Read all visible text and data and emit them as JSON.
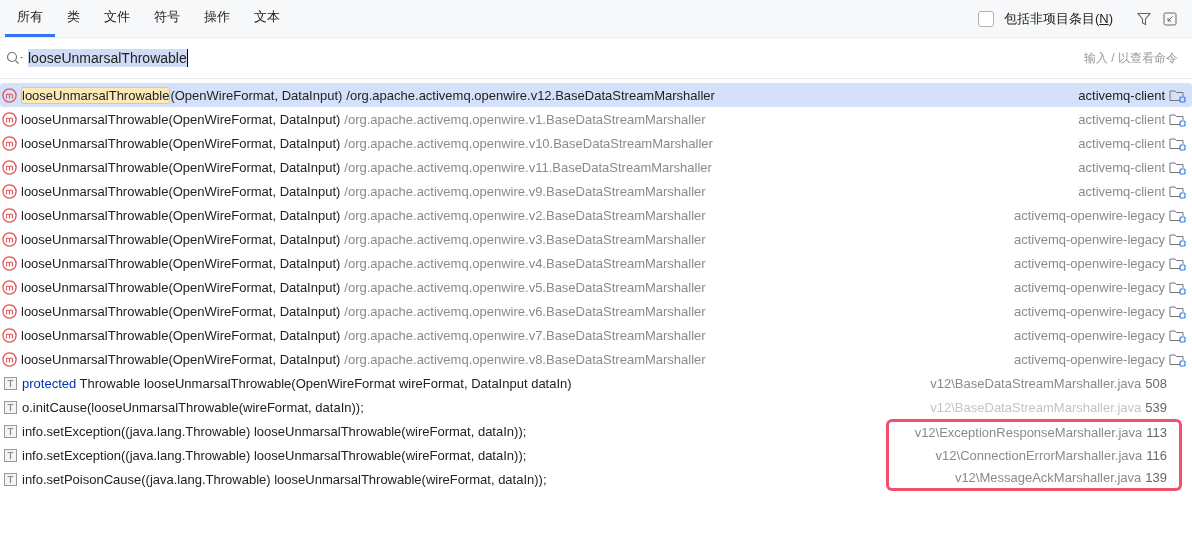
{
  "tabs": [
    {
      "label": "所有",
      "selected": true
    },
    {
      "label": "类",
      "selected": false
    },
    {
      "label": "文件",
      "selected": false
    },
    {
      "label": "符号",
      "selected": false
    },
    {
      "label": "操作",
      "selected": false
    },
    {
      "label": "文本",
      "selected": false
    }
  ],
  "include_non_project": {
    "label": "包括非项目条目(",
    "mnemonic": "N",
    "label_end": ")",
    "checked": false
  },
  "search": {
    "value": "looseUnmarsalThrowable",
    "hint": "输入 / 以查看命令"
  },
  "symbol_results": [
    {
      "method": "looseUnmarsalThrowable",
      "params": "(OpenWireFormat, DataInput)",
      "path": "/org.apache.activemq.openwire.v12.BaseDataStreamMarshaller",
      "module": "activemq-client",
      "selected": true
    },
    {
      "method": "looseUnmarsalThrowable",
      "params": "(OpenWireFormat, DataInput)",
      "path": "/org.apache.activemq.openwire.v1.BaseDataStreamMarshaller",
      "module": "activemq-client",
      "selected": false
    },
    {
      "method": "looseUnmarsalThrowable",
      "params": "(OpenWireFormat, DataInput)",
      "path": "/org.apache.activemq.openwire.v10.BaseDataStreamMarshaller",
      "module": "activemq-client",
      "selected": false
    },
    {
      "method": "looseUnmarsalThrowable",
      "params": "(OpenWireFormat, DataInput)",
      "path": "/org.apache.activemq.openwire.v11.BaseDataStreamMarshaller",
      "module": "activemq-client",
      "selected": false
    },
    {
      "method": "looseUnmarsalThrowable",
      "params": "(OpenWireFormat, DataInput)",
      "path": "/org.apache.activemq.openwire.v9.BaseDataStreamMarshaller",
      "module": "activemq-client",
      "selected": false
    },
    {
      "method": "looseUnmarsalThrowable",
      "params": "(OpenWireFormat, DataInput)",
      "path": "/org.apache.activemq.openwire.v2.BaseDataStreamMarshaller",
      "module": "activemq-openwire-legacy",
      "selected": false
    },
    {
      "method": "looseUnmarsalThrowable",
      "params": "(OpenWireFormat, DataInput)",
      "path": "/org.apache.activemq.openwire.v3.BaseDataStreamMarshaller",
      "module": "activemq-openwire-legacy",
      "selected": false
    },
    {
      "method": "looseUnmarsalThrowable",
      "params": "(OpenWireFormat, DataInput)",
      "path": "/org.apache.activemq.openwire.v4.BaseDataStreamMarshaller",
      "module": "activemq-openwire-legacy",
      "selected": false
    },
    {
      "method": "looseUnmarsalThrowable",
      "params": "(OpenWireFormat, DataInput)",
      "path": "/org.apache.activemq.openwire.v5.BaseDataStreamMarshaller",
      "module": "activemq-openwire-legacy",
      "selected": false
    },
    {
      "method": "looseUnmarsalThrowable",
      "params": "(OpenWireFormat, DataInput)",
      "path": "/org.apache.activemq.openwire.v6.BaseDataStreamMarshaller",
      "module": "activemq-openwire-legacy",
      "selected": false
    },
    {
      "method": "looseUnmarsalThrowable",
      "params": "(OpenWireFormat, DataInput)",
      "path": "/org.apache.activemq.openwire.v7.BaseDataStreamMarshaller",
      "module": "activemq-openwire-legacy",
      "selected": false
    },
    {
      "method": "looseUnmarsalThrowable",
      "params": "(OpenWireFormat, DataInput)",
      "path": "/org.apache.activemq.openwire.v8.BaseDataStreamMarshaller",
      "module": "activemq-openwire-legacy",
      "selected": false
    }
  ],
  "text_results": [
    {
      "keyword": "protected",
      "code": "Throwable looseUnmarsalThrowable(OpenWireFormat wireFormat, DataInput dataIn)",
      "file": "v12\\BaseDataStreamMarshaller.java",
      "line": "508",
      "dimmed": false,
      "outlined": false
    },
    {
      "code": "o.initCause(looseUnmarsalThrowable(wireFormat, dataIn));",
      "file": "v12\\BaseDataStreamMarshaller.java",
      "line": "539",
      "dimmed": true,
      "outlined": false
    },
    {
      "code": "info.setException((java.lang.Throwable) looseUnmarsalThrowable(wireFormat, dataIn));",
      "file": "v12\\ExceptionResponseMarshaller.java",
      "line": "113",
      "dimmed": false,
      "outlined": true
    },
    {
      "code": "info.setException((java.lang.Throwable) looseUnmarsalThrowable(wireFormat, dataIn));",
      "file": "v12\\ConnectionErrorMarshaller.java",
      "line": "116",
      "dimmed": false,
      "outlined": true
    },
    {
      "code": "info.setPoisonCause((java.lang.Throwable) looseUnmarsalThrowable(wireFormat, dataIn));",
      "file": "v12\\MessageAckMarshaller.java",
      "line": "139",
      "dimmed": false,
      "outlined": true
    }
  ]
}
